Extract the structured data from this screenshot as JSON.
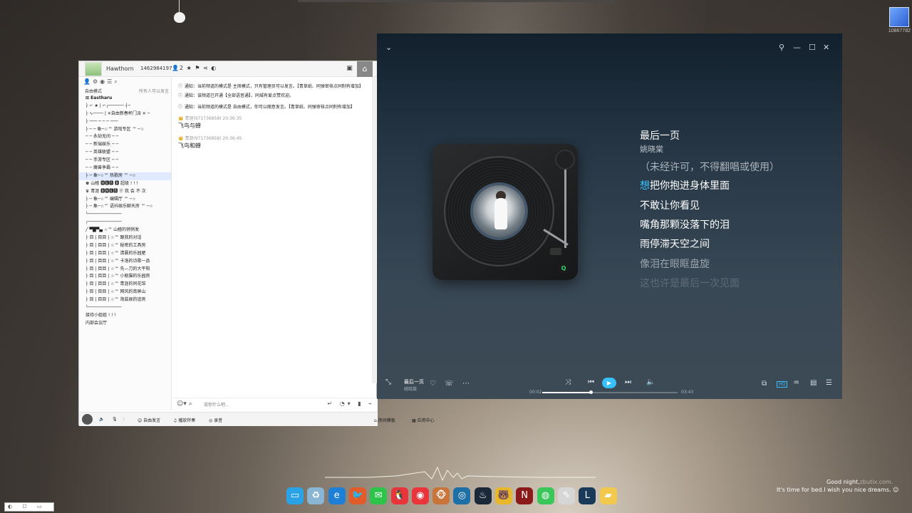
{
  "qq": {
    "user_name": "Hawthorn",
    "room_id": "1462984197",
    "member_count": "2",
    "mode_label": "自由模式",
    "mode_right": "所有人可以发言",
    "server_name": "Eastharu",
    "channels": [
      "├ ⌐ ★ | ⌐┌────── ┤─",
      "├ ∿──── | ✕自由新春杯门派 ✕ ─",
      "├ ─── ─ ─ ─ ───",
      "├ ─ ─ 象─☆™ 游戏专区 ™ ─☆",
      "─ ─ 永劫无间 ─ ─",
      "─ ─ 新瑞娱乐 ─ ─",
      "─ ─ 英雄联盟 ─ ─",
      "─ ─ 手游专区 ─ ─",
      "─ ─ 魔兽争霸 ─ ─",
      "├ ─ 象─☆™ 热歌房 ™ ─☆",
      "♚ 山楂 🅼🅴🅶 🅱 超级 ! ! !",
      "♛ 青涯 🅱🅼🅴🅶 ⓟ 我 会 不 次",
      "├ ─ 象─☆™ 编辑厅 ™ ─☆",
      "├ ─ 象─☆™ 语抖娱乐聊天房 ™ ─☆",
      "└─────────────",
      "┌─────────────",
      "╱ ▀█▀▄ ☆™ 山楂的悄悄发",
      "├ 目 | 目目 | ☆™ 跟我的对话",
      "├ 目 | 目目 | ☆™ 秘密的工具房",
      "├ 目 | 目目 | ☆™ 清晨的乐园屋",
      "├ 目 | 目目 | ☆™ 卡洛的诗歌一品",
      "├ 目 | 目目 | ☆™ 先—刀的大平阳",
      "├ 目 | 目目 | ☆™ 小瓶猫的乐园房",
      "├ 目 | 目目 | ☆™ 青涯的同花馆",
      "├ 目 | 目目 | ☆™ 网风的南屏山",
      "├ 目 | 目目 | ☆™ 淘兹娱的追房",
      "└─────────────",
      "接待小姐姐 ! ! !",
      "内部会议厅"
    ],
    "messages": {
      "notice1": "通知：当前频道的模式是 主席模式，只有管理员可以发言。【青草纸、同弹审核点同制有增加】",
      "notice2": "通知：该频道已开通【全部语音通】，同城有爱点赞欢迎。",
      "notice3": "通知：当前频道的模式是 自由模式，你可以随意发言。【青草纸、同弹审核点同制有增加】",
      "user1": "青涯(971736858)  20:36:35",
      "text1": "飞鸟与蝉",
      "user2": "青涯(971736858)  20:36:45",
      "text2": "飞鸟和蝉"
    },
    "input_placeholder": "说你什么吧...",
    "footer": {
      "free_speak": "自由发言",
      "music": "播放伴奏",
      "record": "录音",
      "sound_effect": "房间模板",
      "app_center": "应用中心"
    }
  },
  "music": {
    "song_title": "最后一页",
    "artist": "姚晓棠",
    "lyrics": {
      "notice": "（未经许可，不得翻唱或使用）",
      "current_first_char": "想",
      "current_rest": "把你抱进身体里面",
      "line2": "不敢让你看见",
      "line3": "嘴角那颗没落下的泪",
      "line4": "雨停滞天空之间",
      "line5": "像泪在眼眶盘旋",
      "line6": "这也许是最后一次见面"
    },
    "player_bar": {
      "song_title": "最后一页",
      "artist": "姚晓棠",
      "time_current": "00:02",
      "time_total": "03:43",
      "quality": "HQ",
      "progress": 0.36
    }
  },
  "desktop": {
    "logo_number": "10867782",
    "tray_line1": "Good night,",
    "tray_line1_suffix": "zbutix.com.",
    "tray_line2": "It's time for bed.I wish you nice dreams.",
    "taskbar_icons": [
      "desktop-icon",
      "recycle-icon",
      "edge-icon",
      "qq-bird-icon",
      "wechat-icon",
      "qq-red-icon",
      "netease-music-icon",
      "monkey-icon",
      "steam-like-icon",
      "steam-icon",
      "bear-icon",
      "naraka-icon",
      "android-icon",
      "notepad-icon",
      "league-icon",
      "folder-icon"
    ]
  }
}
